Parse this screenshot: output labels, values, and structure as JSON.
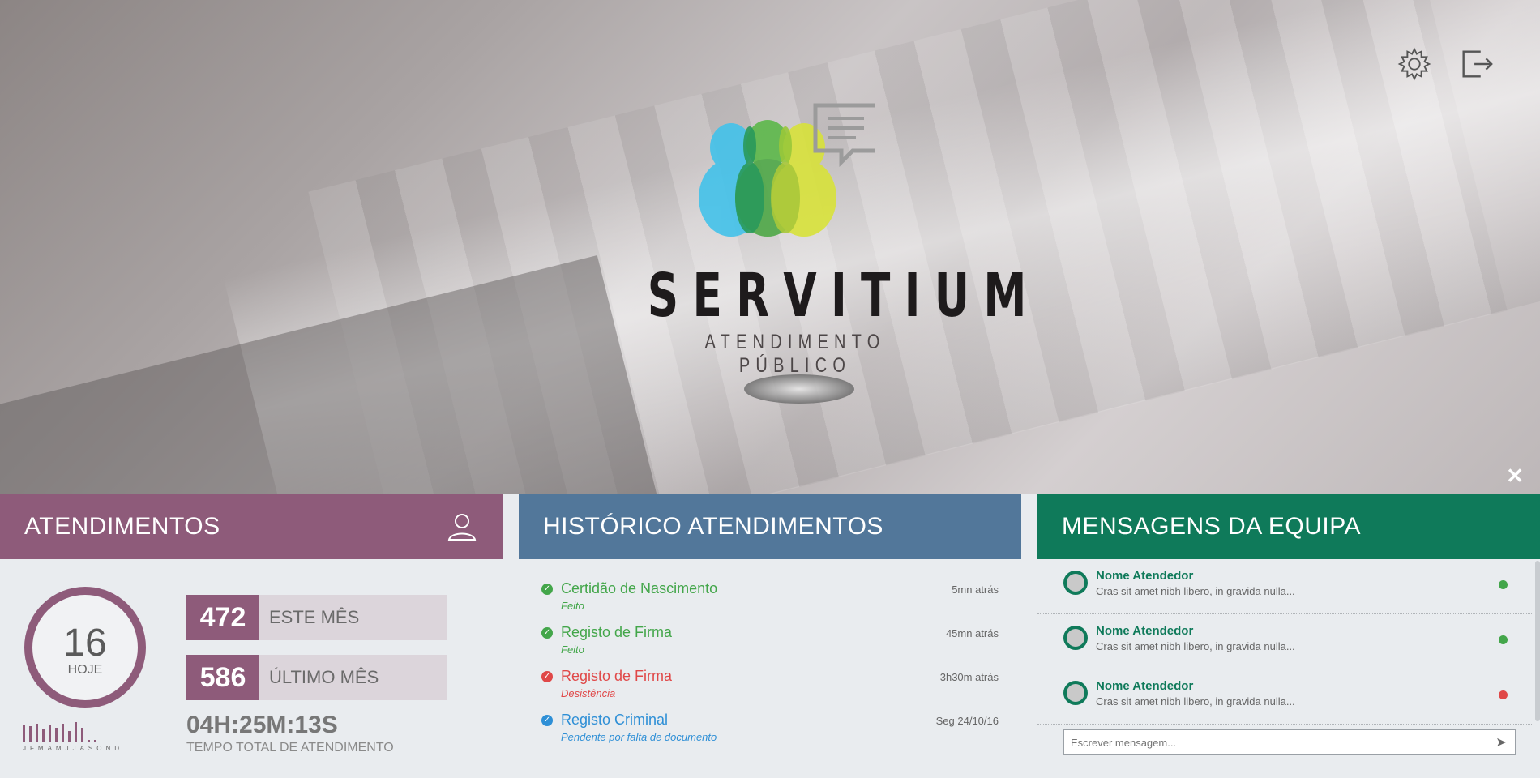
{
  "brand": {
    "name": "SERVITIUM",
    "tagline": "ATENDIMENTO PÚBLICO"
  },
  "top_icons": [
    "gear-icon",
    "logout-icon"
  ],
  "close_label": "✕",
  "panels": {
    "atendimentos": {
      "title": "ATENDIMENTOS",
      "icon": "user-icon",
      "today_value": "16",
      "today_label": "HOJE",
      "months": [
        "J",
        "F",
        "M",
        "A",
        "M",
        "J",
        "J",
        "A",
        "S",
        "O",
        "N",
        "D"
      ],
      "month_levels": [
        0.85,
        0.75,
        0.9,
        0.65,
        0.85,
        0.7,
        0.9,
        0.55,
        0.95,
        0.7,
        0.1,
        0.1
      ],
      "stats": [
        {
          "value": "472",
          "label": "ESTE MÊS"
        },
        {
          "value": "586",
          "label": "ÚLTIMO MÊS"
        }
      ],
      "total_time": "04H:25M:13S",
      "total_label": "TEMPO TOTAL DE ATENDIMENTO"
    },
    "historico": {
      "title": "HISTÓRICO ATENDIMENTOS",
      "items": [
        {
          "title": "Certidão de Nascimento",
          "status": "Feito",
          "time": "5mn atrás",
          "state": "ok"
        },
        {
          "title": "Registo de Firma",
          "status": "Feito",
          "time": "45mn atrás",
          "state": "ok"
        },
        {
          "title": "Registo de Firma",
          "status": "Desistência",
          "time": "3h30m atrás",
          "state": "bad"
        },
        {
          "title": "Registo Criminal",
          "status": "Pendente por falta de documento",
          "time": "Seg 24/10/16",
          "state": "info"
        }
      ]
    },
    "mensagens": {
      "title": "MENSAGENS DA EQUIPA",
      "items": [
        {
          "name": "Nome Atendedor",
          "text": "Cras sit amet nibh libero, in gravida nulla...",
          "online": true
        },
        {
          "name": "Nome Atendedor",
          "text": "Cras sit amet nibh libero, in gravida nulla...",
          "online": true
        },
        {
          "name": "Nome Atendedor",
          "text": "Cras sit amet nibh libero, in gravida nulla...",
          "online": false
        }
      ],
      "input_placeholder": "Escrever mensagem...",
      "send_icon": "send-icon"
    }
  },
  "colors": {
    "atendimentos": "#8e5b7a",
    "historico": "#52779a",
    "mensagens": "#0f7a5a",
    "ok": "#43a64a",
    "bad": "#e04848",
    "info": "#2e8fd6"
  }
}
